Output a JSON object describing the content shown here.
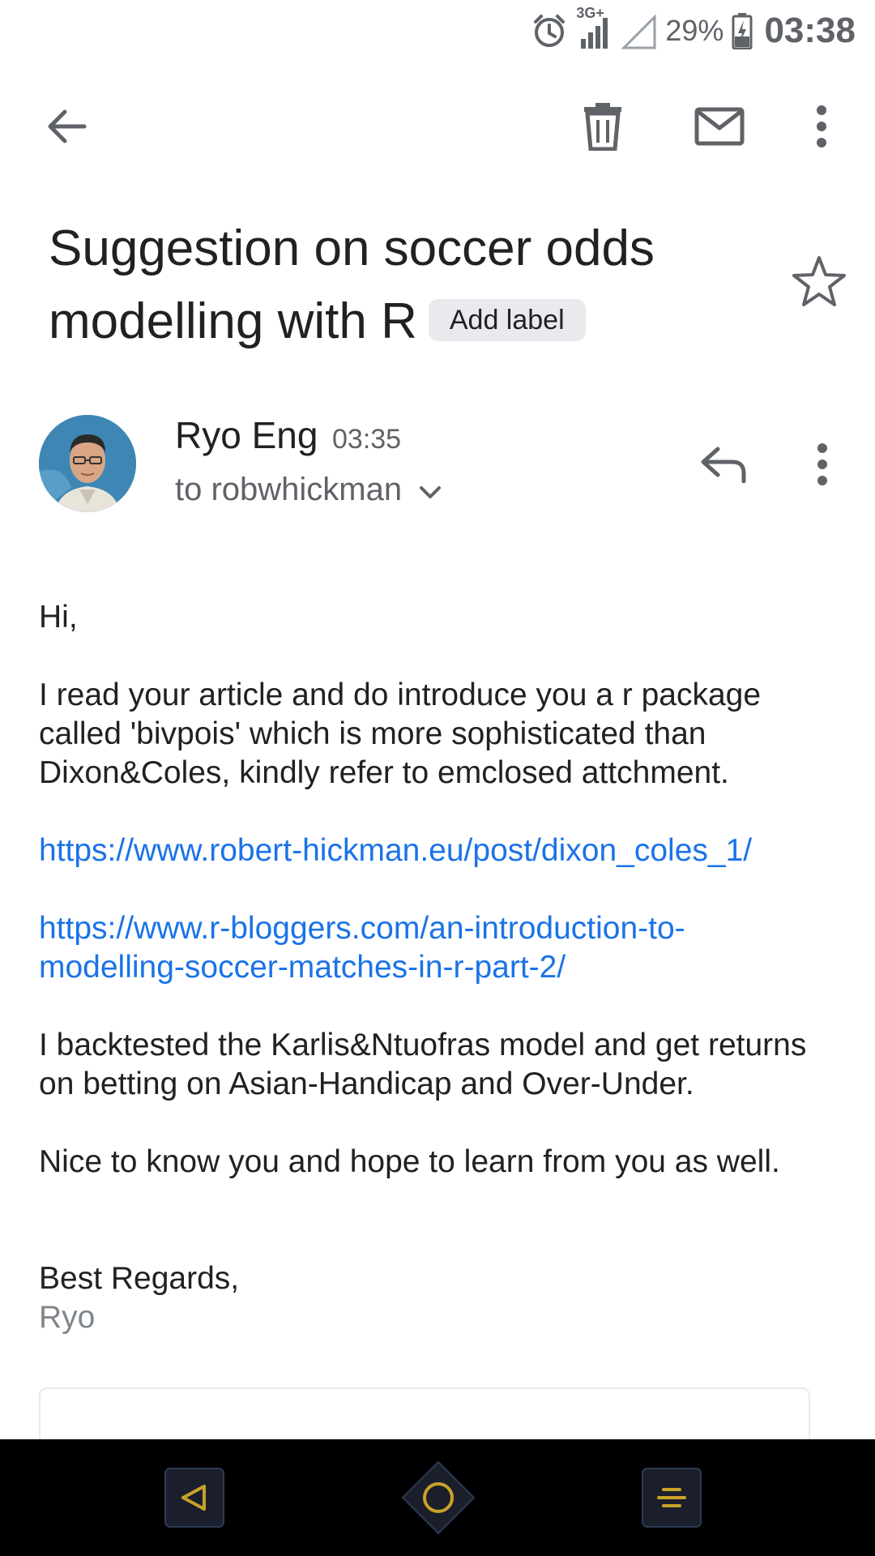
{
  "status_bar": {
    "network": "3G+",
    "battery": "29%",
    "time": "03:38",
    "icons": [
      "alarm-icon",
      "signal-icon",
      "signal-empty-icon",
      "battery-charging-icon"
    ]
  },
  "toolbar": {
    "icons": [
      "back-arrow-icon",
      "delete-icon",
      "mark-unread-icon",
      "more-vert-icon"
    ]
  },
  "email": {
    "subject": "Suggestion on soccer odds modelling with R",
    "label_button": "Add label",
    "sender": "Ryo Eng",
    "time": "03:35",
    "recipient": "to robwhickman",
    "body": {
      "greeting": "Hi,",
      "para1": "I read your article and do introduce you a r package called 'bivpois' which is more sophisticated than Dixon&Coles, kindly refer to emclosed attchment.",
      "link1": "https://www.robert-hickman.eu/post/dixon_coles_1/",
      "link2_line1": "https://www.r-bloggers.com/an-introduction-to-",
      "link2_line2": "modelling-soccer-matches-in-r-part-2/",
      "para2": "I backtested the Karlis&Ntuofras model and get returns on betting on Asian-Handicap and Over-Under.",
      "para3": "Nice to know you and hope to learn from you as well.",
      "closing": "Best Regards,",
      "signature": "Ryo"
    }
  },
  "colors": {
    "link": "#1a73e8",
    "secondary_text": "#5f6368",
    "nav_accent": "#c9a227"
  }
}
